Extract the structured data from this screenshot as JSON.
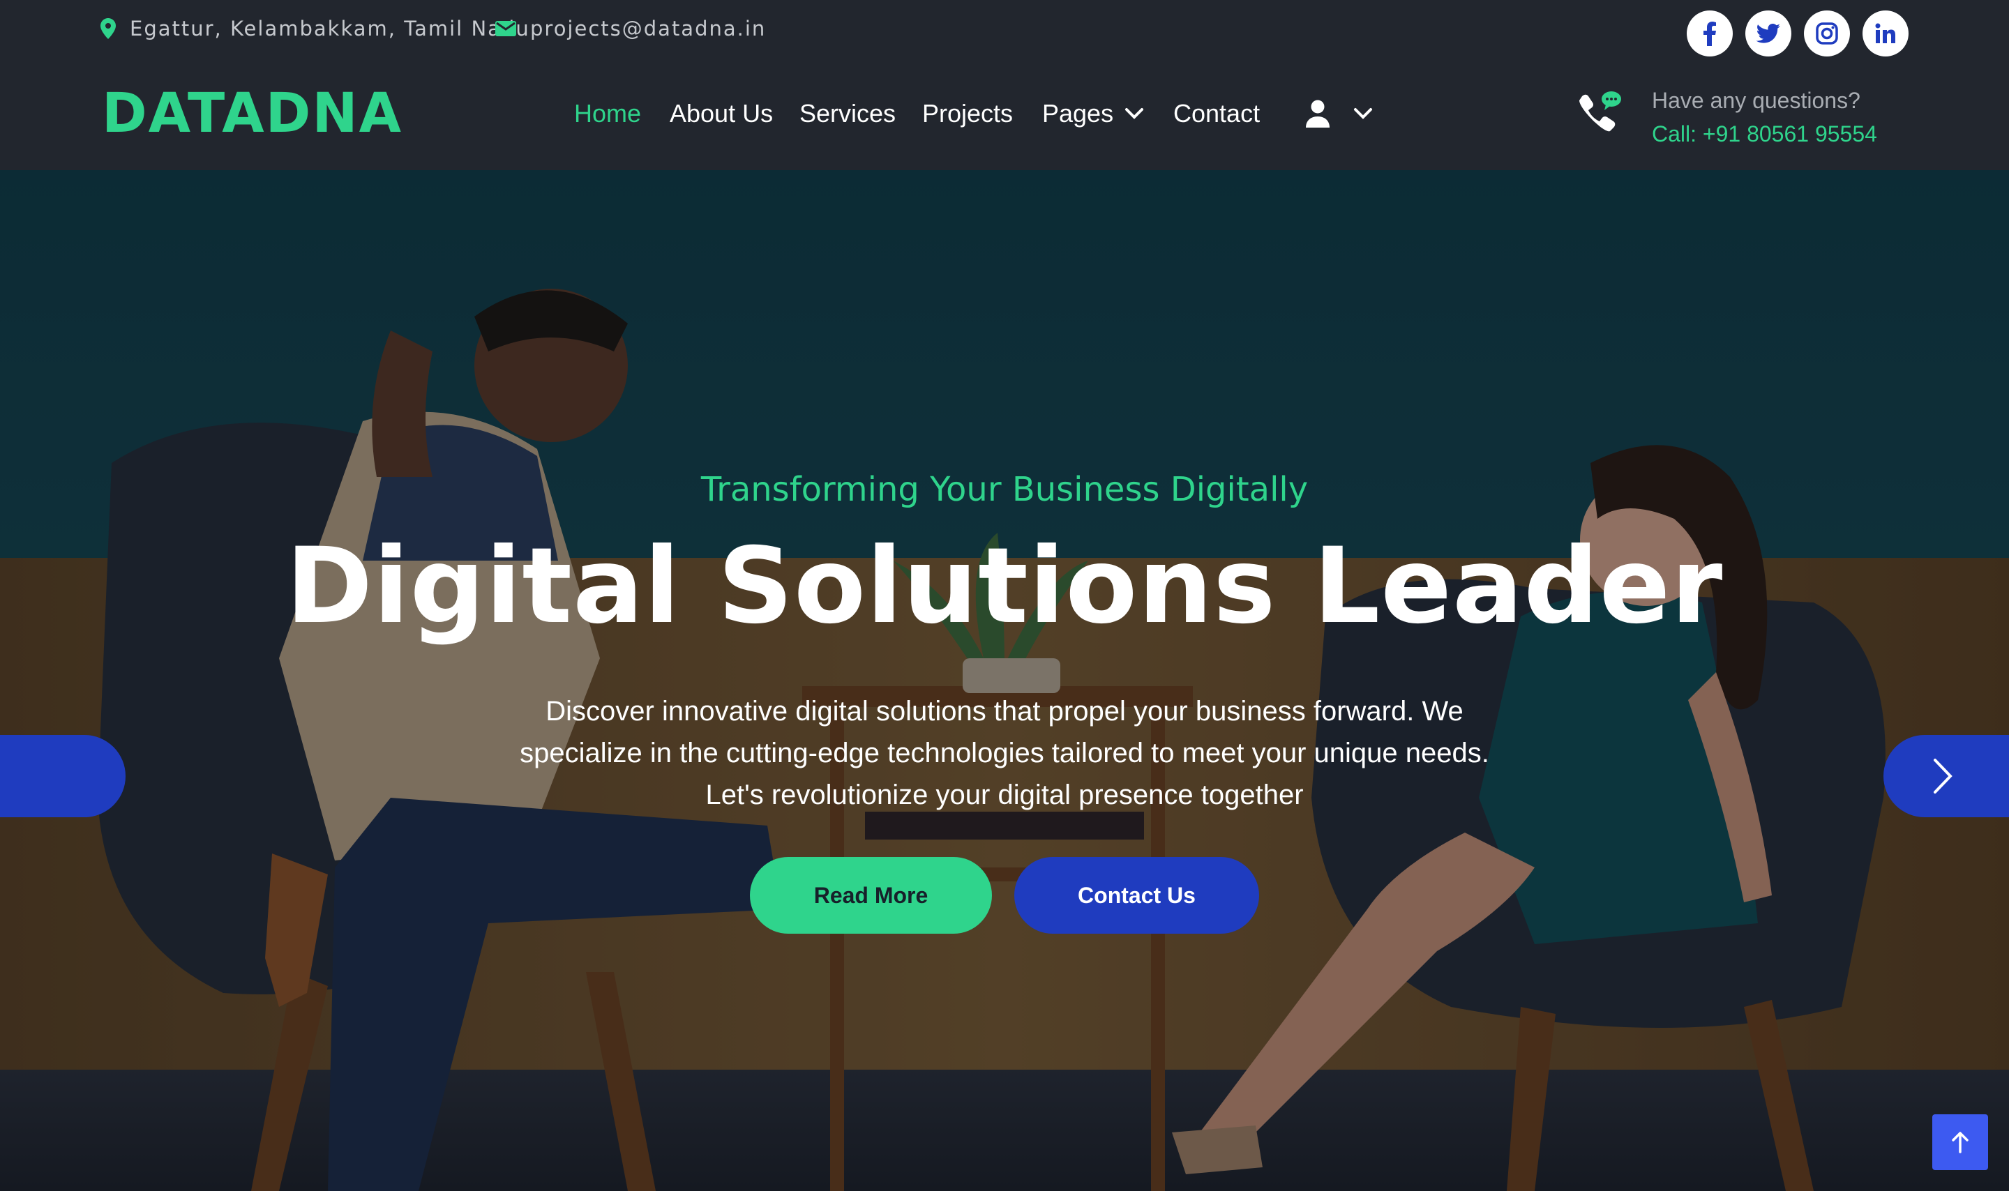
{
  "topbar": {
    "location": "Egattur, Kelambakkam, Tamil Nadu",
    "email": "projects@datadna.in",
    "social_icons": [
      "facebook-icon",
      "twitter-icon",
      "instagram-icon",
      "linkedin-icon"
    ]
  },
  "navbar": {
    "brand": "DATADNA",
    "links": [
      "Home",
      "About Us",
      "Services",
      "Projects",
      "Pages",
      "Contact"
    ],
    "active": "Home",
    "questions_label": "Have any questions?",
    "call_label": "Call: +91 80561 95554"
  },
  "hero": {
    "kicker": "Transforming Your Business Digitally",
    "headline": "Digital Solutions Leader",
    "description_lines": [
      "Discover innovative digital solutions that propel your business forward. We",
      "specialize in the cutting-edge technologies tailored to meet your unique needs.",
      "Let's revolutionize your digital presence together"
    ],
    "read_more_label": "Read More",
    "contact_label": "Contact Us"
  },
  "colors": {
    "accent": "#2fd48c",
    "primary": "#1f3cbf",
    "dark": "#22262e"
  }
}
